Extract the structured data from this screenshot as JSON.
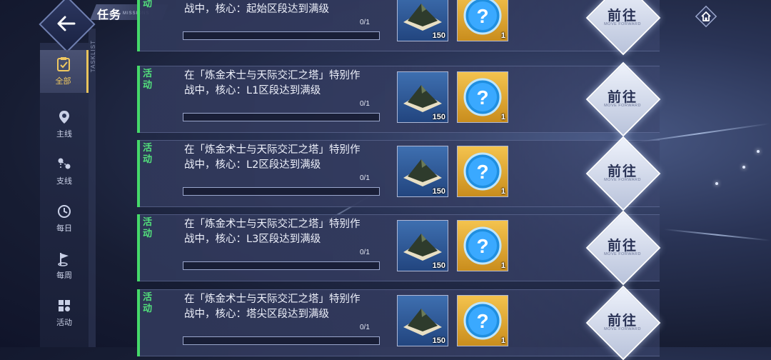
{
  "header": {
    "title": "任务",
    "subtitle": "MISSIONS",
    "sidebar_vertical_label": "TASKLIST"
  },
  "nav": [
    {
      "label": "全部",
      "icon": "clipboard-icon",
      "active": true
    },
    {
      "label": "主线",
      "icon": "location-pin-icon",
      "active": false
    },
    {
      "label": "支线",
      "icon": "branch-pins-icon",
      "active": false
    },
    {
      "label": "每日",
      "icon": "clock-icon",
      "active": false
    },
    {
      "label": "每周",
      "icon": "flag-icon",
      "active": false
    },
    {
      "label": "活动",
      "icon": "grid-icon",
      "active": false
    }
  ],
  "tasks": [
    {
      "tag": "活动",
      "text": "在「炼金术士与天际交汇之塔」特别作战中，核心：起始区段达到满级",
      "progress": "0/1",
      "rewards": [
        {
          "icon": "terrain-icon",
          "count": "150"
        },
        {
          "icon": "question-orb-icon",
          "count": "1"
        }
      ],
      "button": "前往",
      "button_sub": "MOVE FORWARD"
    },
    {
      "tag": "活动",
      "text": "在「炼金术士与天际交汇之塔」特别作战中，核心：L1区段达到满级",
      "progress": "0/1",
      "rewards": [
        {
          "icon": "terrain-icon",
          "count": "150"
        },
        {
          "icon": "question-orb-icon",
          "count": "1"
        }
      ],
      "button": "前往",
      "button_sub": "MOVE FORWARD"
    },
    {
      "tag": "活动",
      "text": "在「炼金术士与天际交汇之塔」特别作战中，核心：L2区段达到满级",
      "progress": "0/1",
      "rewards": [
        {
          "icon": "terrain-icon",
          "count": "150"
        },
        {
          "icon": "question-orb-icon",
          "count": "1"
        }
      ],
      "button": "前往",
      "button_sub": "MOVE FORWARD"
    },
    {
      "tag": "活动",
      "text": "在「炼金术士与天际交汇之塔」特别作战中，核心：L3区段达到满级",
      "progress": "0/1",
      "rewards": [
        {
          "icon": "terrain-icon",
          "count": "150"
        },
        {
          "icon": "question-orb-icon",
          "count": "1"
        }
      ],
      "button": "前往",
      "button_sub": "MOVE FORWARD"
    },
    {
      "tag": "活动",
      "text": "在「炼金术士与天际交汇之塔」特别作战中，核心：塔尖区段达到满级",
      "progress": "0/1",
      "rewards": [
        {
          "icon": "terrain-icon",
          "count": "150"
        },
        {
          "icon": "question-orb-icon",
          "count": "1"
        }
      ],
      "button": "前往",
      "button_sub": "MOVE FORWARD"
    }
  ],
  "colors": {
    "accent_green": "#45d96a",
    "active_gold": "#e9c45c"
  }
}
